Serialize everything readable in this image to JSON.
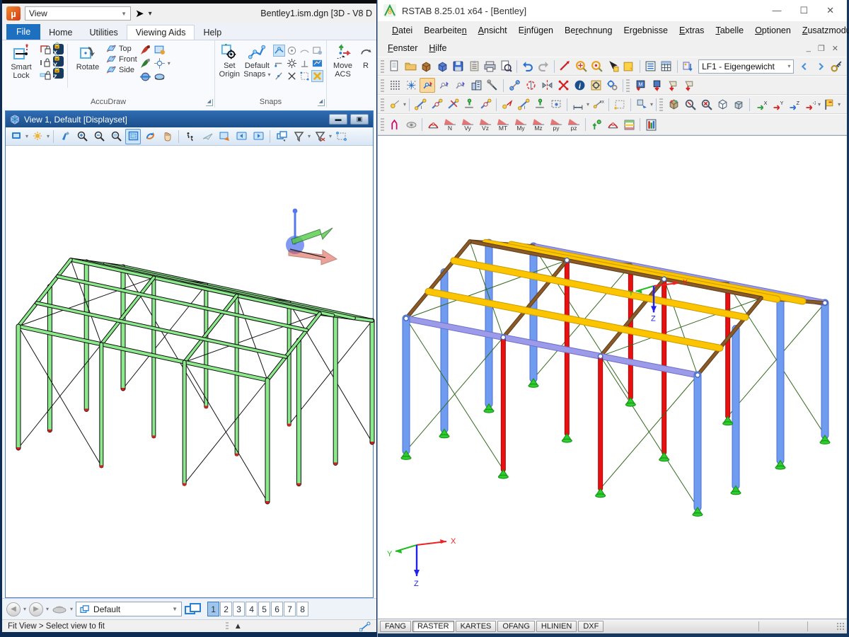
{
  "microstation": {
    "qat": {
      "app_button": "View",
      "doc_title": "Bentley1.ism.dgn [3D - V8 D"
    },
    "tabs": [
      {
        "label": "File",
        "style": "file"
      },
      {
        "label": "Home",
        "style": ""
      },
      {
        "label": "Utilities",
        "style": ""
      },
      {
        "label": "Viewing Aids",
        "style": "active"
      },
      {
        "label": "Help",
        "style": ""
      }
    ],
    "ribbon": {
      "accudraw": {
        "label": "AccuDraw",
        "smart_lock": "Smart Lock",
        "rotate": "Rotate",
        "plane_buttons": [
          "Top",
          "Front",
          "Side"
        ],
        "lock_letters": [
          "X",
          "Y",
          "Z"
        ]
      },
      "snaps": {
        "label": "Snaps",
        "set_origin": "Set Origin",
        "default_snaps": "Default Snaps"
      },
      "acs": {
        "move_acs": "Move ACS",
        "rotate_acs_partial": "R"
      }
    },
    "view_window": {
      "title": "View 1, Default [Displayset]"
    },
    "bottom": {
      "view_group": "Default",
      "view_numbers": [
        "1",
        "2",
        "3",
        "4",
        "5",
        "6",
        "7",
        "8"
      ],
      "active_view": "1"
    },
    "status": {
      "message": "Fit View > Select view to fit"
    },
    "model_palette": {
      "member": "#8ce98c",
      "outline": "#0a0a0a",
      "brace": "#111111",
      "base_tick": "#cc2222",
      "triad_sphere": "#5577ee",
      "triad_y": "#55cc44",
      "triad_x": "#dd5544"
    }
  },
  "rstab": {
    "title": "RSTAB 8.25.01 x64 - [Bentley]",
    "menus": [
      {
        "label": "Datei",
        "u": 0
      },
      {
        "label": "Bearbeiten",
        "u": 9
      },
      {
        "label": "Ansicht",
        "u": 0
      },
      {
        "label": "Einfügen",
        "u": 1
      },
      {
        "label": "Berechnung",
        "u": 2
      },
      {
        "label": "Ergebnisse",
        "u": 2
      },
      {
        "label": "Extras",
        "u": 0
      },
      {
        "label": "Tabelle",
        "u": 0
      },
      {
        "label": "Optionen",
        "u": 0
      },
      {
        "label": "Zusatzmodule",
        "u": 0
      }
    ],
    "menus2": [
      {
        "label": "Fenster",
        "u": 0
      },
      {
        "label": "Hilfe",
        "u": 0
      }
    ],
    "loadcase": "LF1 - Eigengewicht",
    "result_buttons": [
      "N",
      "Vy",
      "Vz",
      "MT",
      "My",
      "Mz",
      "py",
      "pz"
    ],
    "view_axis_buttons": [
      "X",
      "Y",
      "Z",
      "-X"
    ],
    "status_toggles": [
      {
        "label": "FANG",
        "active": false
      },
      {
        "label": "RASTER",
        "active": true
      },
      {
        "label": "KARTES",
        "active": false
      },
      {
        "label": "OFANG",
        "active": false
      },
      {
        "label": "HLINIEN",
        "active": false
      },
      {
        "label": "DXF",
        "active": false
      }
    ],
    "axes": {
      "x": "X",
      "y": "Y",
      "z": "Z",
      "x_color": "#ee2222",
      "y_color": "#22bb22",
      "z_color": "#2222ee"
    },
    "model_palette": {
      "column_gable": "#6f9bf0",
      "column_gable_edge": "#4a6fd0",
      "column_inner": "#e81010",
      "column_inner_edge": "#a80808",
      "eave_beam": "#9b9bea",
      "eave_beam_edge": "#6f6fc8",
      "purlin": "#fdc400",
      "purlin_edge": "#c89a00",
      "rafter": "#8a5a28",
      "rafter_edge": "#5f3d18",
      "brace": "#336b1e",
      "support": "#2ecc2e",
      "support_edge": "#129012",
      "hinge": "#4466bb"
    }
  }
}
